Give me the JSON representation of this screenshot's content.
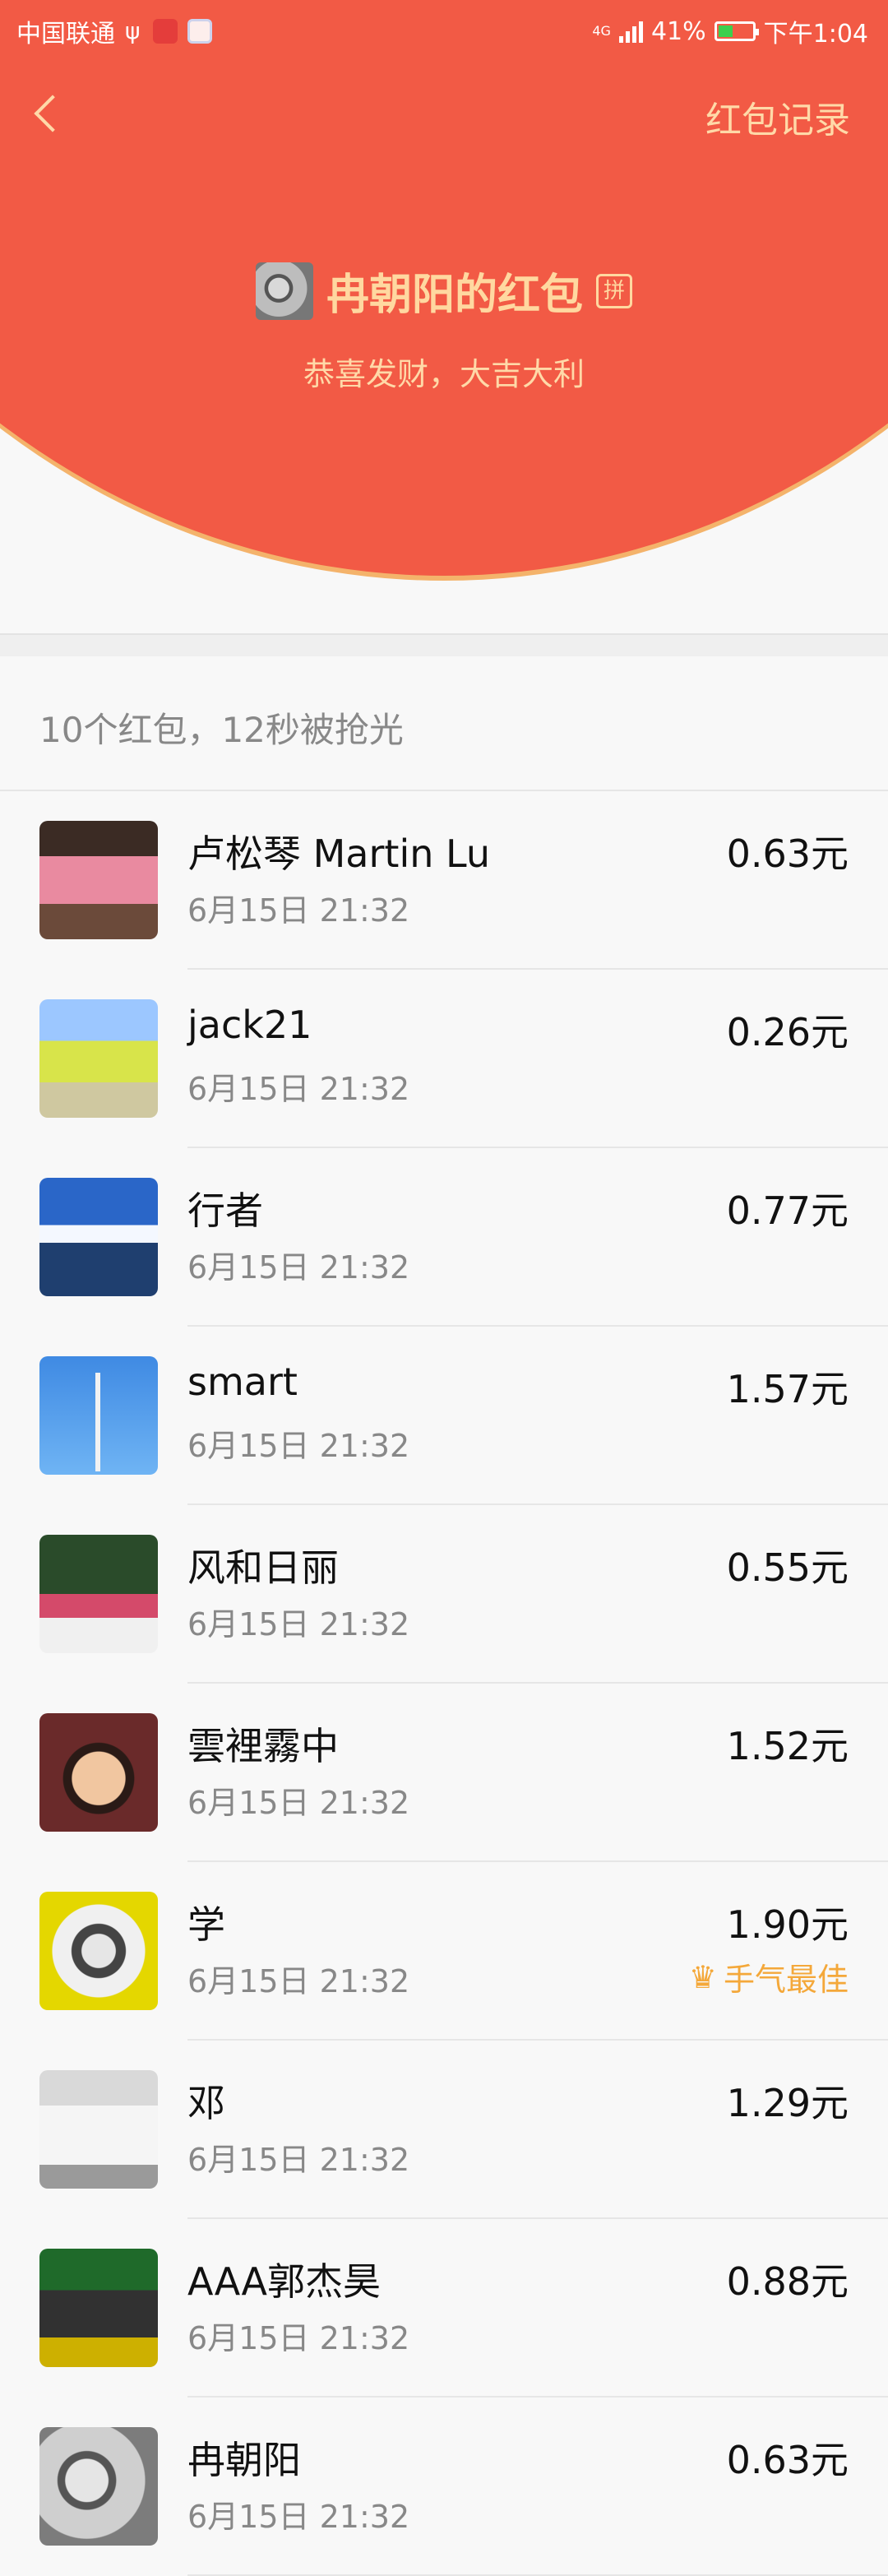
{
  "status_bar": {
    "carrier": "中国联通",
    "network": "4G",
    "battery": "41%",
    "time": "下午1:04"
  },
  "header": {
    "records_label": "红包记录",
    "sender_name": "冉朝阳的红包",
    "badge": "拼",
    "greeting": "恭喜发财，大吉大利"
  },
  "summary": "10个红包，12秒被抢光",
  "entries": [
    {
      "name": "卢松琴 Martin Lu",
      "time": "6月15日  21:32",
      "amount": "0.63元",
      "best": ""
    },
    {
      "name": "jack21",
      "time": "6月15日  21:32",
      "amount": "0.26元",
      "best": ""
    },
    {
      "name": "行者",
      "time": "6月15日  21:32",
      "amount": "0.77元",
      "best": ""
    },
    {
      "name": "smart",
      "time": "6月15日  21:32",
      "amount": "1.57元",
      "best": ""
    },
    {
      "name": "风和日丽",
      "time": "6月15日  21:32",
      "amount": "0.55元",
      "best": ""
    },
    {
      "name": "雲裡霧中",
      "time": "6月15日  21:32",
      "amount": "1.52元",
      "best": ""
    },
    {
      "name": "学",
      "time": "6月15日  21:32",
      "amount": "1.90元",
      "best": "手气最佳"
    },
    {
      "name": "邓",
      "time": "6月15日  21:32",
      "amount": "1.29元",
      "best": ""
    },
    {
      "name": "AAA郭杰昊",
      "time": "6月15日  21:32",
      "amount": "0.88元",
      "best": ""
    },
    {
      "name": "冉朝阳",
      "time": "6月15日  21:32",
      "amount": "0.63元",
      "best": ""
    }
  ]
}
